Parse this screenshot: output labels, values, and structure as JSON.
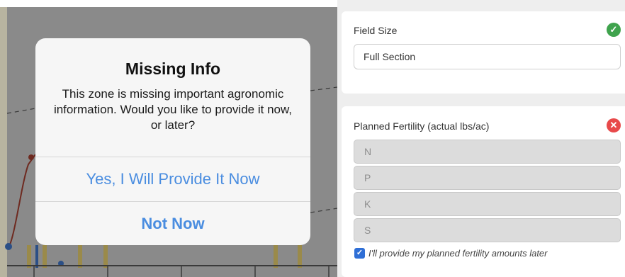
{
  "alert": {
    "title": "Missing Info",
    "message": "This zone is missing important agronomic information. Would you like to provide it now, or later?",
    "primary_button": "Yes, I Will Provide It Now",
    "secondary_button": "Not Now"
  },
  "field_size": {
    "label": "Field Size",
    "value": "Full Section",
    "status_icon": "check-circle-icon",
    "status_color": "#3fa34d"
  },
  "fertility": {
    "label": "Planned Fertility (actual lbs/ac)",
    "status_icon": "error-circle-icon",
    "status_color": "#e8494a",
    "inputs": [
      {
        "placeholder": "N"
      },
      {
        "placeholder": "P"
      },
      {
        "placeholder": "K"
      },
      {
        "placeholder": "S"
      }
    ],
    "later_checkbox": {
      "checked": true,
      "label": "I'll provide my planned fertility amounts later"
    }
  },
  "colors": {
    "accent_blue": "#4a8de0",
    "checkbox_blue": "#2f6fd6",
    "overlay_gray": "#8a8a8a"
  }
}
